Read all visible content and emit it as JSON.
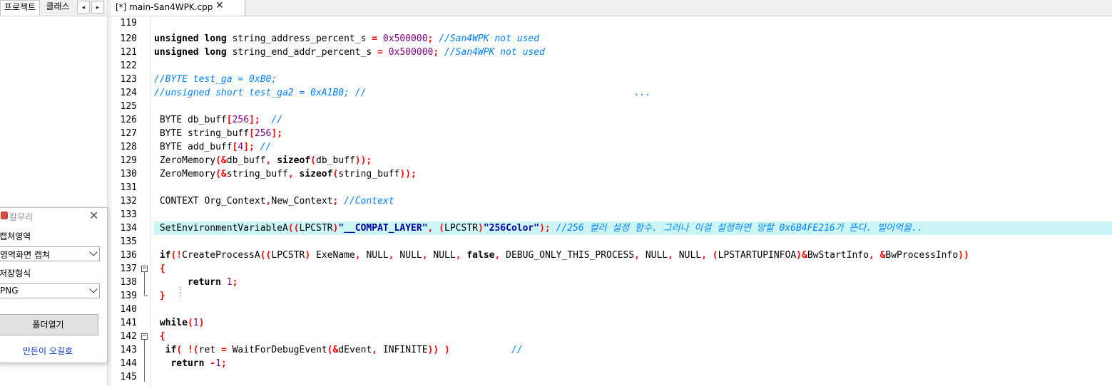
{
  "left_panel": {
    "tabs": [
      "프로젝트",
      "클래스"
    ],
    "arrow_left": "◂",
    "arrow_right": "▸"
  },
  "editor": {
    "tab_label": "[*] main-San4WPK.cpp",
    "tab_close": "✕",
    "lines": [
      {
        "n": "119",
        "fold": ""
      },
      {
        "n": "120",
        "fold": ""
      },
      {
        "n": "121",
        "fold": ""
      },
      {
        "n": "122",
        "fold": ""
      },
      {
        "n": "123",
        "fold": ""
      },
      {
        "n": "124",
        "fold": ""
      },
      {
        "n": "125",
        "fold": ""
      },
      {
        "n": "126",
        "fold": ""
      },
      {
        "n": "127",
        "fold": ""
      },
      {
        "n": "128",
        "fold": ""
      },
      {
        "n": "129",
        "fold": ""
      },
      {
        "n": "130",
        "fold": ""
      },
      {
        "n": "131",
        "fold": ""
      },
      {
        "n": "132",
        "fold": ""
      },
      {
        "n": "133",
        "fold": ""
      },
      {
        "n": "134",
        "fold": ""
      },
      {
        "n": "135",
        "fold": ""
      },
      {
        "n": "136",
        "fold": ""
      },
      {
        "n": "137",
        "fold": "−"
      },
      {
        "n": "138",
        "fold": ""
      },
      {
        "n": "139",
        "fold": ""
      },
      {
        "n": "140",
        "fold": ""
      },
      {
        "n": "141",
        "fold": ""
      },
      {
        "n": "142",
        "fold": "−"
      },
      {
        "n": "143",
        "fold": ""
      },
      {
        "n": "144",
        "fold": ""
      },
      {
        "n": "145",
        "fold": ""
      }
    ],
    "highlighted_line": "134"
  },
  "capture_tool": {
    "title": "칼무리",
    "close": "✕",
    "area_label": "캡쳐영역",
    "area_value": "영역화면 캡쳐",
    "format_label": "저장형식",
    "format_value": "PNG",
    "folder_button": "폴더열기",
    "maker_link": "만든이 오길호"
  },
  "colors": {
    "keyword": "#000000",
    "number": "#800080",
    "operator": "#ff0000",
    "comment": "#0080ff",
    "string": "#0000a0",
    "highlight": "#ccf6f6"
  }
}
